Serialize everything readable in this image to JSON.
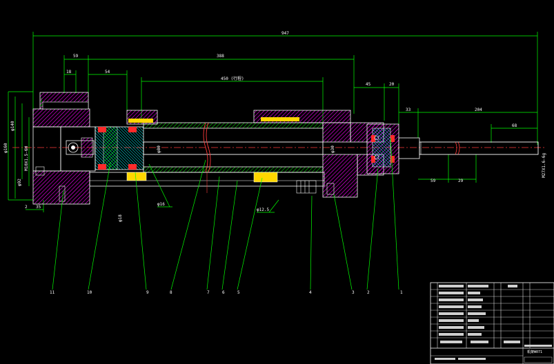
{
  "drawing": {
    "dimensions": {
      "overall_length": "947",
      "barrel_span": "388",
      "left_flange": "59",
      "left_step": "18",
      "left_block": "54",
      "stroke": "450 (行程)",
      "right_span_a": "45",
      "right_span_b": "20",
      "rod_a": "33",
      "rod_b": "204",
      "rod_end": "68",
      "bottom_a": "59",
      "bottom_b": "29",
      "bottom_left_a": "2",
      "bottom_left_b": "35",
      "thread": "M27X1.6-6g",
      "left_thread": "M10X1.5-6H",
      "vertical_a": "φ160",
      "vertical_b": "φ140",
      "vertical_c": "φ92",
      "diam_piston": "φ80",
      "diam_rod": "φ30",
      "callout_a": "φ16",
      "callout_b": "φ18",
      "callout_c": "φ12.5"
    },
    "part_numbers": [
      "11",
      "10",
      "9",
      "8",
      "7",
      "6",
      "5",
      "4",
      "3",
      "2",
      "1"
    ],
    "title_block": {
      "name": "机架W071"
    },
    "colors": {
      "background": "#000000",
      "outline": "#ffffff",
      "dimension": "#00ff00",
      "hatch": "#ff00ff",
      "centerline": "#ff3b3b",
      "seal": "#ff2a2a",
      "spring": "#ffff00",
      "thread_gold": "#ffd700",
      "cyan": "#00ffff"
    }
  }
}
